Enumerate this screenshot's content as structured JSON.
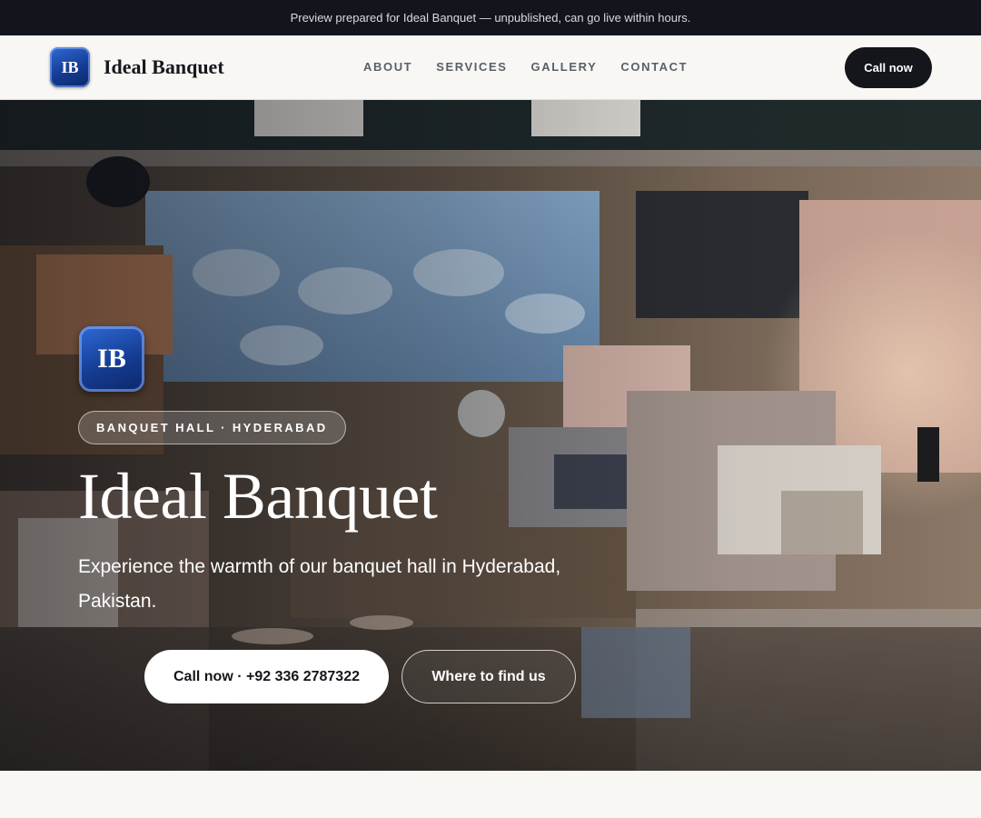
{
  "topbar": {
    "notice": "Preview prepared for Ideal Banquet — unpublished, can go live within hours."
  },
  "navbar": {
    "logo_initials": "IB",
    "brand_name": "Ideal Banquet",
    "links": [
      {
        "label": "ABOUT"
      },
      {
        "label": "SERVICES"
      },
      {
        "label": "GALLERY"
      },
      {
        "label": "CONTACT"
      }
    ],
    "cta_label": "Call now"
  },
  "hero": {
    "logo_initials": "IB",
    "chip": "BANQUET HALL · HYDERABAD",
    "title": "Ideal Banquet",
    "subtitle": "Experience the warmth of our banquet hall in Hyderabad, Pakistan.",
    "primary_button": "Call now · +92 336 2787322",
    "secondary_button": "Where to find us"
  },
  "colors": {
    "topbar_bg": "#12151b",
    "accent_dark": "#14161b",
    "logo_blue": "#153d94",
    "page_bg": "#f8f7f3"
  }
}
